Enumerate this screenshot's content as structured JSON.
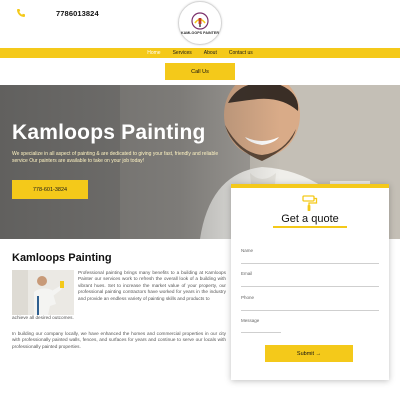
{
  "header": {
    "phone": "7786013824",
    "logo_text": "KAMLOOPS PAINTER",
    "call_button_label": "Call Us"
  },
  "nav": {
    "items": [
      {
        "label": "Home",
        "active": true
      },
      {
        "label": "Services",
        "active": false
      },
      {
        "label": "About",
        "active": false
      },
      {
        "label": "Contact us",
        "active": false
      }
    ]
  },
  "hero": {
    "title": "Kamloops Painting",
    "description": "We specialize in all aspect of painting & are dedicated to giving your fast, friendly and reliable service Our painters are available to take on your job today!",
    "button_label": "778-601-3824"
  },
  "quote": {
    "title": "Get a quote",
    "fields": [
      {
        "label": "Name"
      },
      {
        "label": "Email"
      },
      {
        "label": "Phone"
      },
      {
        "label": "Message"
      }
    ],
    "submit_label": "Submit →"
  },
  "about": {
    "title": "Kamloops Painting",
    "paragraph1": "Professional painting brings many benefits to a building at Kamloops Painter our services work to refresh the overall look of a building with vibrant hues. Set to increase the market value of your property, our professional painting contractors have worked for years in the industry and provide an endless variety of painting skills and products to",
    "paragraph1_tail": "achieve all desired outcomes.",
    "paragraph2": "In building our company locally, we have enhanced the homes and commercial properties in our city with professionally painted walls, fences, and surfaces for years and continue to serve our locals with professionally painted properties."
  },
  "colors": {
    "accent": "#f4c91a",
    "text_dark": "#111111",
    "text_body": "#555555"
  },
  "icons": {
    "phone": "phone-icon",
    "quote": "paint-roller-icon",
    "logo": "brush-emblem-icon"
  }
}
